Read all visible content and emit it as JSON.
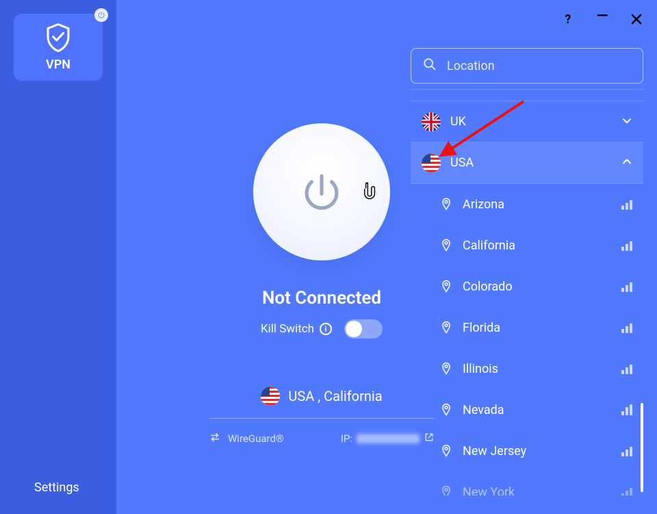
{
  "sidebar": {
    "vpn_label": "VPN",
    "settings_label": "Settings"
  },
  "titlebar": {
    "help": "?",
    "minimize": "—",
    "close": "×"
  },
  "center": {
    "status": "Not Connected",
    "kill_switch_label": "Kill Switch",
    "selected_location": "USA , California",
    "protocol": "WireGuard®",
    "ip_label": "IP:"
  },
  "panel": {
    "search_placeholder": "Location",
    "countries": [
      {
        "name": "UK",
        "expanded": false,
        "flag": "uk"
      },
      {
        "name": "USA",
        "expanded": true,
        "flag": "us",
        "cities": [
          {
            "name": "Arizona"
          },
          {
            "name": "California"
          },
          {
            "name": "Colorado"
          },
          {
            "name": "Florida"
          },
          {
            "name": "Illinois"
          },
          {
            "name": "Nevada",
            "signal": "full"
          },
          {
            "name": "New Jersey"
          },
          {
            "name": "New York",
            "faded": true
          }
        ]
      }
    ]
  }
}
